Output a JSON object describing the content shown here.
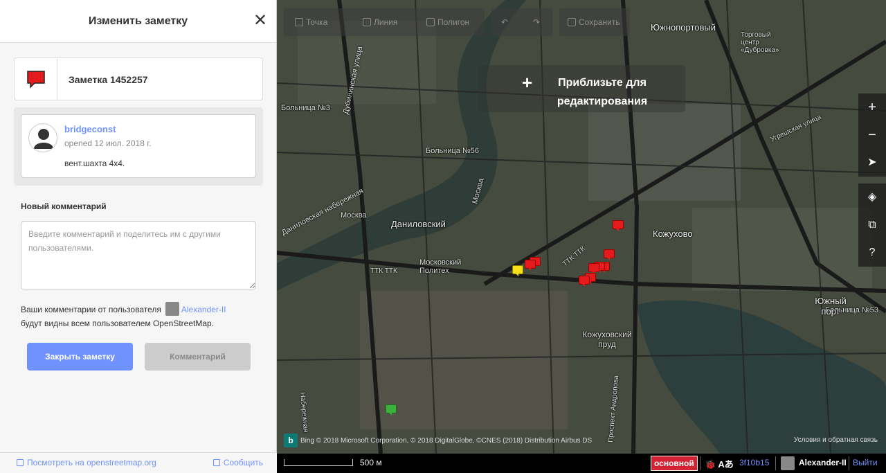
{
  "sidebar": {
    "title": "Изменить заметку",
    "close_glyph": "✕",
    "note": {
      "label": "Заметка 1452257",
      "icon": "note-icon",
      "icon_color": "#e41a1c"
    },
    "comment": {
      "user": "bridgeconst",
      "date": "opened 12 июл. 2018 г.",
      "text": "вент.шахта 4x4."
    },
    "new_comment": {
      "label": "Новый комментарий",
      "placeholder": "Введите комментарий и поделитесь им с другими пользователями."
    },
    "notice": {
      "prefix": "Ваши комментарии от пользователя",
      "user": "Alexander-II",
      "suffix": "будут видны всем пользователем OpenStreetMap."
    },
    "buttons": {
      "close_note": "Закрыть заметку",
      "comment": "Комментарий"
    },
    "footer": {
      "view_on_osm": "Посмотреть на openstreetmap.org",
      "report": "Сообщить"
    }
  },
  "map": {
    "toolbar": {
      "point": "Точка",
      "line": "Линия",
      "area": "Полигон",
      "save": "Сохранить",
      "save_count": "0"
    },
    "zoom_prompt": {
      "plus": "+",
      "text": "Приблизьте для редактирования"
    },
    "controls": {
      "zoom_in": "+",
      "zoom_out": "−",
      "locate": "➤",
      "layers": "◈",
      "map_data": "⧉",
      "help": "?"
    },
    "labels": {
      "yuzhnoportovy": "Южнопортовый",
      "torgovy": "Торговый центр «Дубровка»",
      "bolnitsa3": "Больница №3",
      "bolnitsa56": "Больница №56",
      "bolnitsa53": "Больница №53",
      "moskva_river": "Москва",
      "moskva_river2": "Москва",
      "danilovsky": "Даниловский",
      "danilovskaya_nab": "Даниловская набережная",
      "dubininskaya": "Дубининская улица",
      "kozhukhovo": "Кожухово",
      "yuzhny_port": "Южный порт",
      "kozh_prud": "Кожуховский пруд",
      "moskovsky_politekh": "Московский Политех",
      "ttk": "ТТК ТТК",
      "ttk2": "ТТК ТТК",
      "ugreshskaya": "Угрешская улица",
      "andropova": "Проспект Андропова",
      "naberezh_bottom": "Набережная"
    },
    "attribution": {
      "bing": "b",
      "text": "Bing  © 2018 Microsoft Corporation, © 2018 DigitalGlobe, ©CNES (2018) Distribution Airbus DS",
      "terms": "Условия и обратная связь"
    }
  },
  "bottombar": {
    "scale": "500 м",
    "env": "основной",
    "issues": "🐞 Aあ",
    "version": "3f10b15",
    "user": "Alexander-II",
    "logout": "Выйти"
  },
  "colors": {
    "accent": "#7092ff",
    "note_red": "#e41a1c",
    "note_yellow": "#f5e11b",
    "note_green": "#3bb33b"
  }
}
